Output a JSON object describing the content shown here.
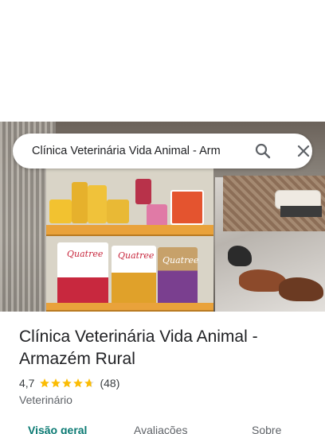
{
  "search": {
    "query": "Clínica Veterinária Vida Animal - Arm"
  },
  "place": {
    "title": "Clínica Veterinária Vida Animal - Armazém Rural",
    "rating": "4,7",
    "stars": 4.7,
    "review_count": "(48)",
    "category": "Veterinário"
  },
  "photo": {
    "bag_brand": "Quatree"
  },
  "tabs": [
    {
      "label": "Visão geral",
      "active": true
    },
    {
      "label": "Avaliações",
      "active": false
    },
    {
      "label": "Sobre",
      "active": false
    }
  ],
  "colors": {
    "accent": "#0b7a73",
    "star": "#fbbc04",
    "text": "#202124",
    "muted": "#5f6368"
  },
  "icons": [
    "search-icon",
    "close-icon",
    "star-icon"
  ]
}
